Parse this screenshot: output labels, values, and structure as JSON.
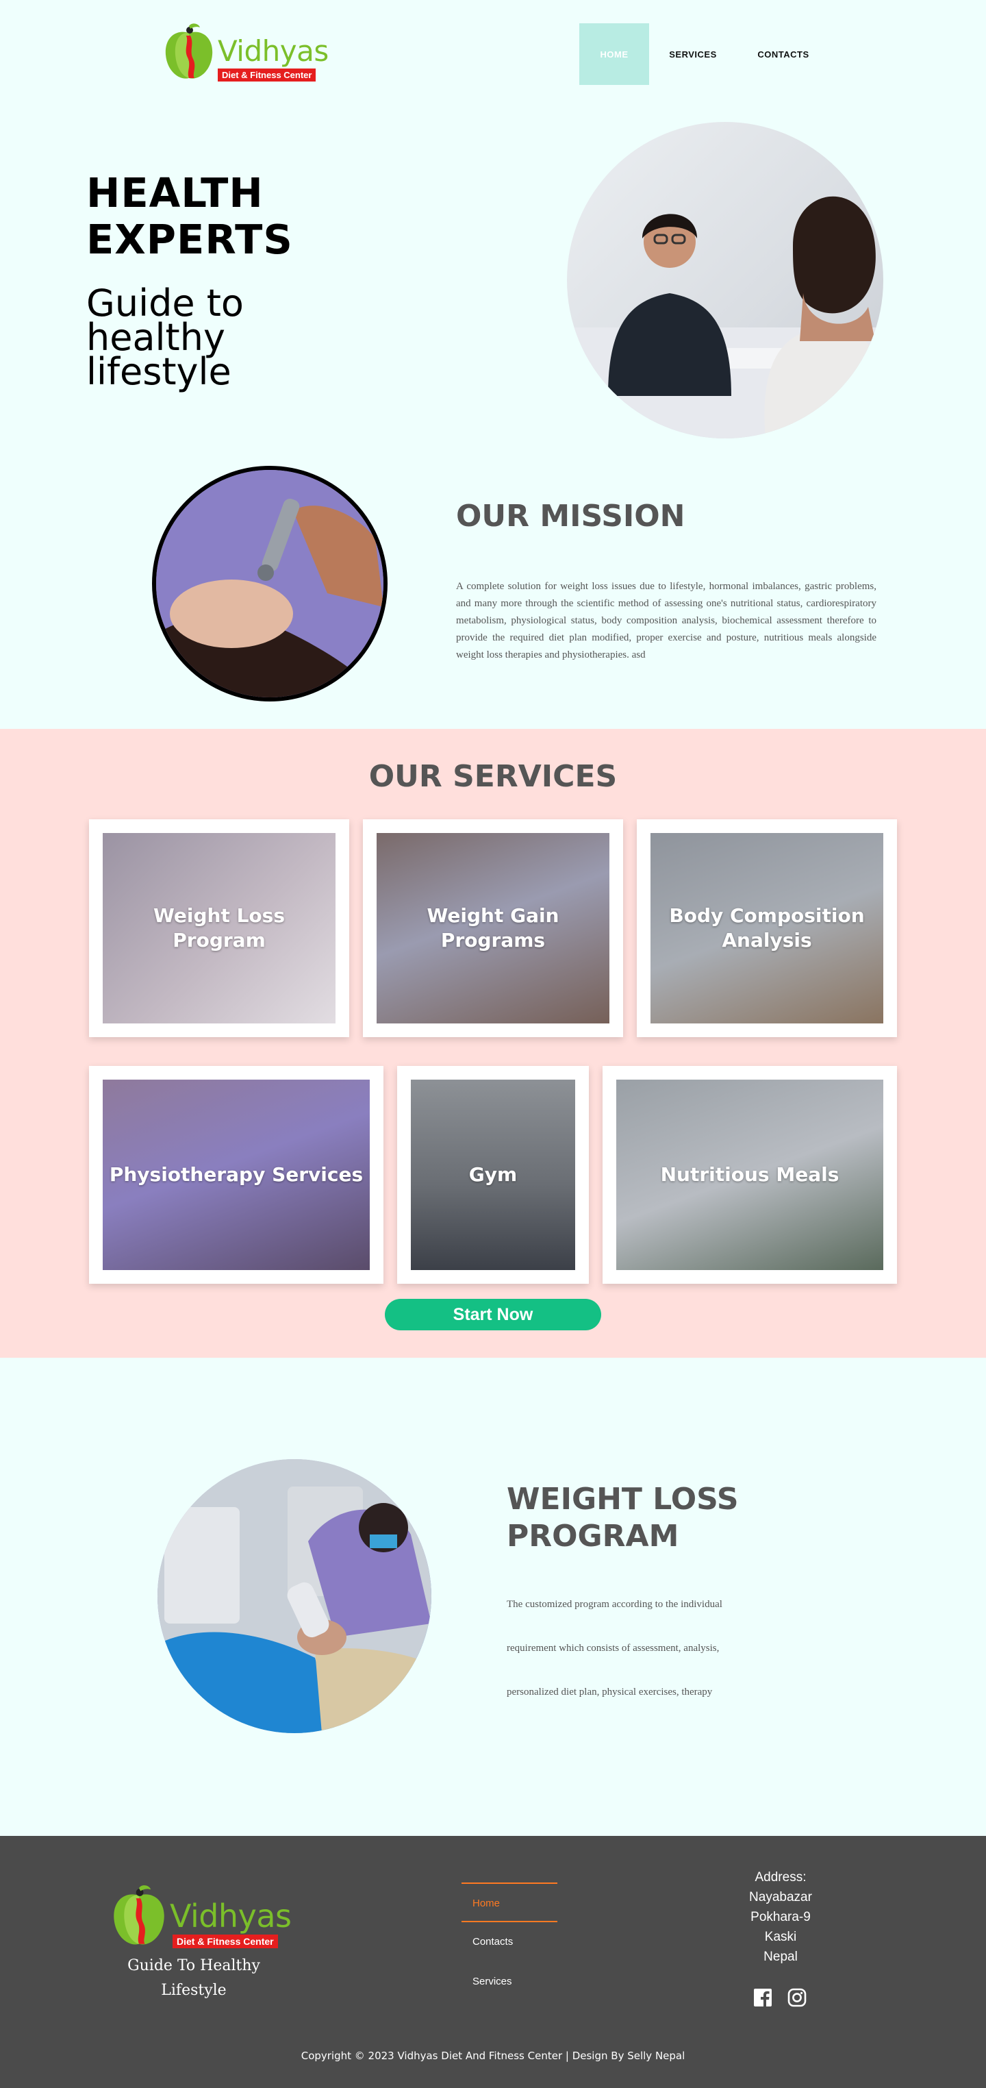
{
  "brand": {
    "name": "Vidhyas",
    "tagline": "Diet & Fitness Center"
  },
  "nav": {
    "items": [
      "HOME",
      "SERVICES",
      "CONTACTS"
    ],
    "active": "HOME"
  },
  "hero": {
    "title": "HEALTH EXPERTS",
    "subtitle": "Guide to healthy lifestyle"
  },
  "mission": {
    "title": "OUR MISSION",
    "text": "A complete solution for weight loss issues due to lifestyle, hormonal imbalances, gastric problems, and many more through the scientific method of assessing one's nutritional status, cardiorespiratory metabolism, physiological status, body composition analysis, biochemical assessment therefore to provide the required diet plan modified, proper exercise and posture, nutritious meals alongside weight loss therapies and physiotherapies. asd"
  },
  "services": {
    "title": "OUR SERVICES",
    "cards": [
      {
        "label": "Weight Loss Program"
      },
      {
        "label": "Weight Gain Programs"
      },
      {
        "label": "Body Composition Analysis"
      },
      {
        "label": "Physiotherapy Services"
      },
      {
        "label": "Gym"
      },
      {
        "label": "Nutritious Meals"
      }
    ],
    "cta": "Start Now"
  },
  "weight_loss": {
    "title": "WEIGHT LOSS PROGRAM",
    "lines": [
      "The customized program according to the individual",
      "requirement which consists of assessment, analysis,",
      "personalized diet plan, physical exercises, therapy"
    ]
  },
  "footer": {
    "tagline": "Guide To Healthy Lifestyle",
    "links": [
      "Home",
      "Contacts",
      "Services"
    ],
    "address": {
      "label": "Address:",
      "lines": [
        "Nayabazar",
        "Pokhara-9",
        "Kaski",
        "Nepal"
      ]
    },
    "social": [
      "facebook-icon",
      "instagram-icon"
    ],
    "copyright": "Copyright © 2023 Vidhyas Diet And Fitness Center | Design By Selly Nepal"
  },
  "colors": {
    "page_bg": "#effffd",
    "services_bg": "#ffdfdc",
    "nav_active": "#b8ece3",
    "cta": "#14c084",
    "footer_bg": "#4b4b4b",
    "footer_accent": "#ff7a22",
    "brand_green": "#7bbf2a",
    "brand_red": "#e51e1e"
  }
}
